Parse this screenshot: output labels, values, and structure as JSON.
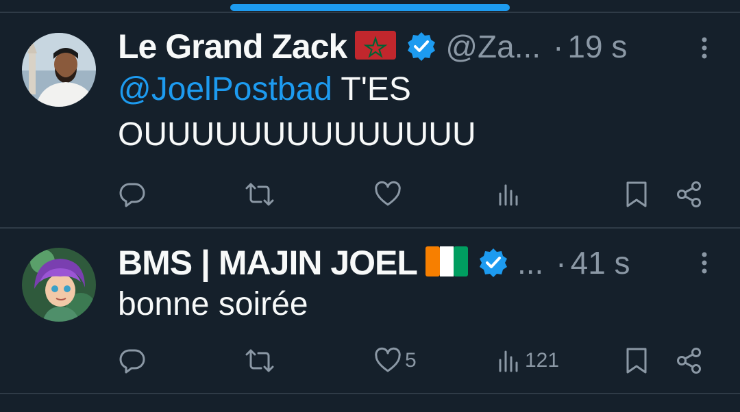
{
  "tweets": [
    {
      "display_name": "Le Grand Zack",
      "flag": "Morocco",
      "verified": true,
      "handle": "@Za...",
      "separator": "·",
      "time": "19 s",
      "mention": "@JoelPostbad",
      "text_line1": " T'ES",
      "text_line2": "OUUUUUUUUUUUUUU",
      "likes": "",
      "views": ""
    },
    {
      "display_name": "BMS | MAJIN JOEL",
      "flag": "Côte d'Ivoire",
      "verified": true,
      "handle": "...",
      "separator": "·",
      "time": "41 s",
      "text": "bonne soirée",
      "likes": "5",
      "views": "121"
    }
  ],
  "icons": {
    "reply": "reply-icon",
    "retweet": "retweet-icon",
    "like": "heart-icon",
    "views": "views-icon",
    "bookmark": "bookmark-icon",
    "share": "share-icon",
    "more": "more-vertical-icon"
  },
  "colors": {
    "background": "#15202b",
    "accent": "#1d9bf0",
    "secondary_text": "#8b98a5",
    "divider": "#2f3b47"
  }
}
